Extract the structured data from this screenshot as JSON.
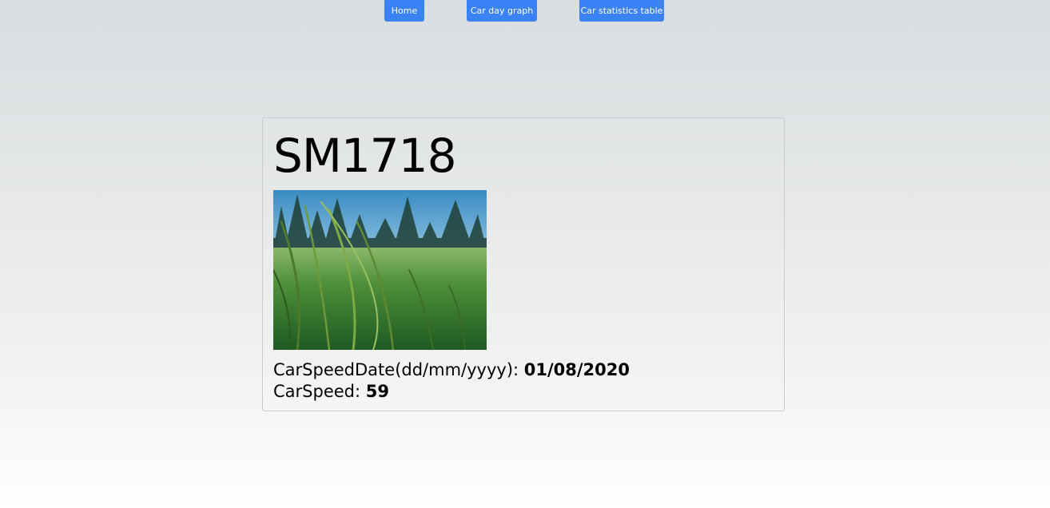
{
  "nav": {
    "home_label": "Home",
    "graph_label": "Car day graph",
    "table_label": "Car statistics table",
    "button_color": "#3b82f6"
  },
  "card": {
    "car_id": "SM1718",
    "image_icon": "grass-field-photo",
    "speed_date_label": "CarSpeedDate(dd/mm/yyyy): ",
    "speed_date_value": "01/08/2020",
    "speed_label": "CarSpeed: ",
    "speed_value": "59"
  }
}
